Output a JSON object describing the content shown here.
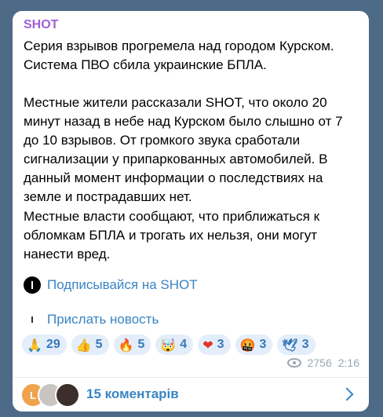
{
  "post": {
    "channel": "SHOT",
    "paragraphs": [
      "Серия взрывов прогремела над городом Курском.\nСистема ПВО сбила украинские БПЛА.",
      "Местные жители рассказали SHOT, что около 20 минут назад в небе над Курском было слышно от 7 до 10 взрывов. От громкого звука сработали сигнализации у припаркованных автомобилей. В данный момент информации о последствиях на земле и пострадавших нет.",
      "Местные власти сообщают, что приближаться к обломкам БПЛА и трогать их нельзя, они могут нанести вред."
    ],
    "subscribe_link": "Подписывайся на SHOT",
    "send_news_link": "Прислать новость"
  },
  "reactions": [
    {
      "emoji": "🙏",
      "icon": "praying-hands-icon",
      "count": "29"
    },
    {
      "emoji": "👍",
      "icon": "thumbs-up-icon",
      "count": "5"
    },
    {
      "emoji": "🔥",
      "icon": "fire-icon",
      "count": "5"
    },
    {
      "emoji": "🤯",
      "icon": "exploding-head-icon",
      "count": "4"
    },
    {
      "emoji": "❤",
      "icon": "heart-icon",
      "count": "3"
    },
    {
      "emoji": "🤬",
      "icon": "angry-face-icon",
      "count": "3"
    },
    {
      "emoji": "🕊",
      "icon": "dove-icon",
      "count": "3"
    }
  ],
  "meta": {
    "views": "2756",
    "time": "2:16"
  },
  "comments": {
    "avatar_letter": "L",
    "label": "15 коментарів"
  },
  "colors": {
    "background": "#4d6a86",
    "bubble": "#ffffff",
    "channel_name": "#a05fd6",
    "link": "#3a84c4",
    "reaction_bg": "#e3eefa"
  }
}
